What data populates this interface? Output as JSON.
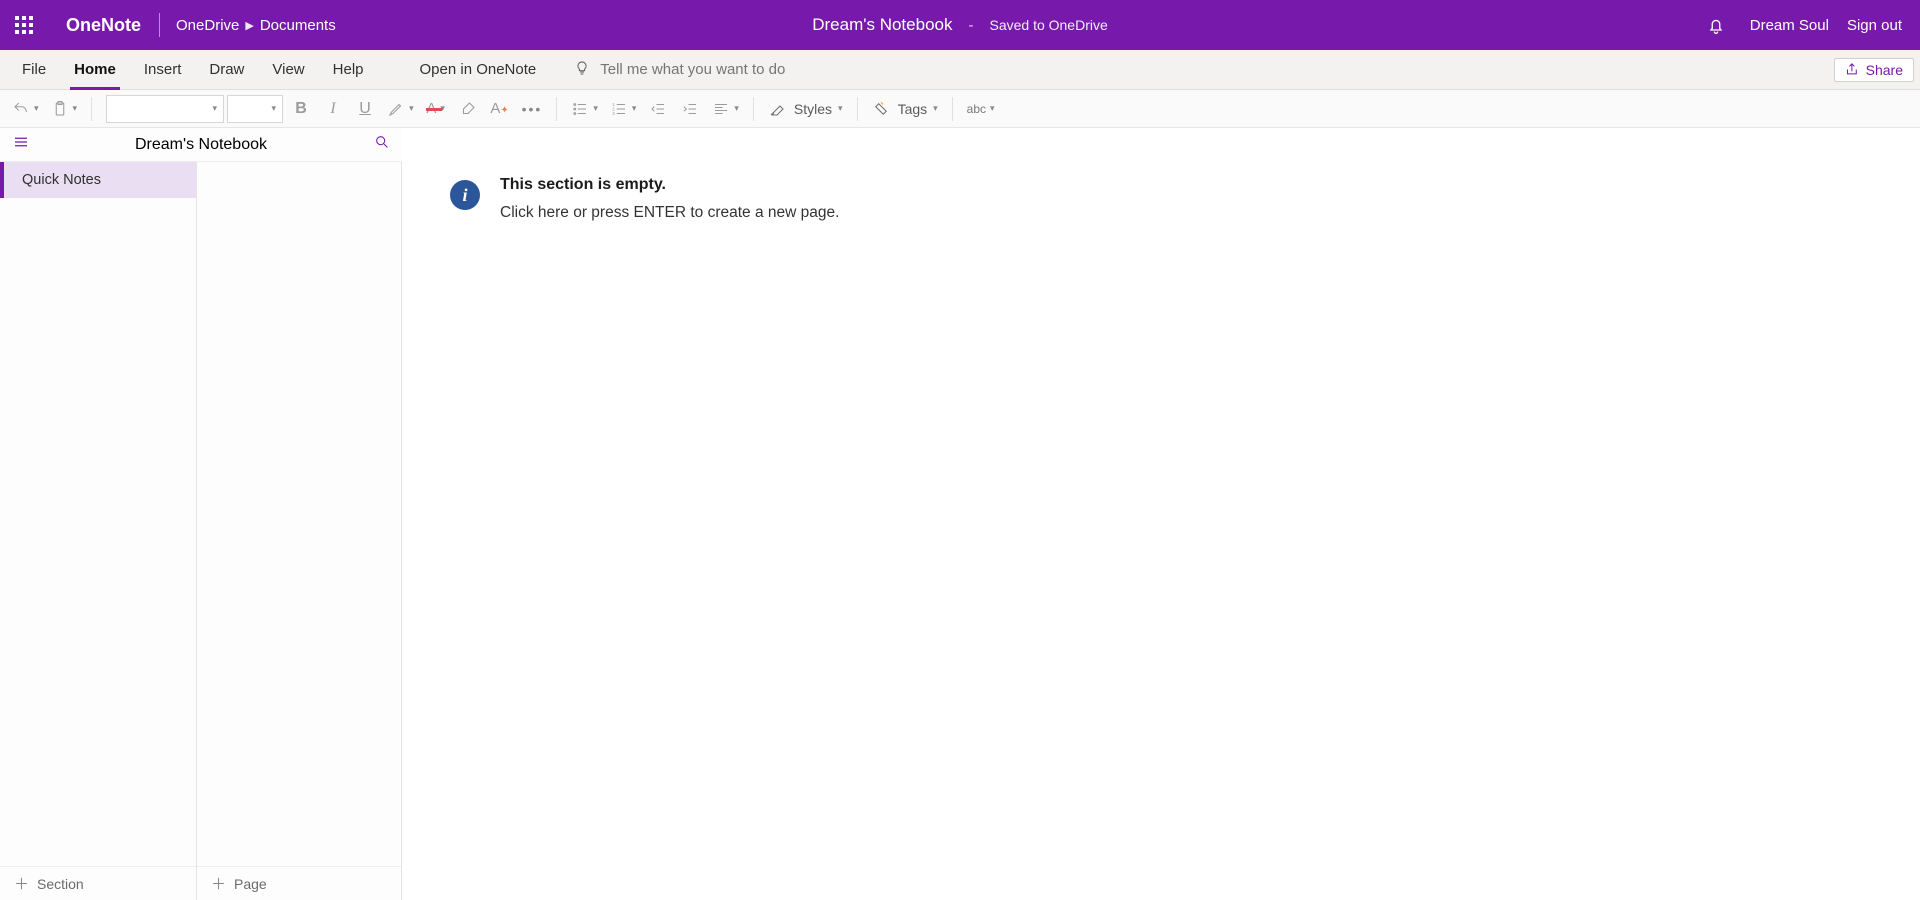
{
  "titlebar": {
    "app_name": "OneNote",
    "breadcrumb": [
      "OneDrive",
      "Documents"
    ],
    "notebook_title": "Dream's Notebook",
    "saved_status": "Saved to OneDrive",
    "user_name": "Dream Soul",
    "sign_out": "Sign out"
  },
  "ribbon": {
    "tabs": [
      "File",
      "Home",
      "Insert",
      "Draw",
      "View",
      "Help",
      "Open in OneNote"
    ],
    "active_tab": "Home",
    "tell_me_placeholder": "Tell me what you want to do",
    "share_label": "Share",
    "groups": {
      "styles_label": "Styles",
      "tags_label": "Tags"
    }
  },
  "nav": {
    "notebook_name": "Dream's Notebook",
    "sections": [
      "Quick Notes"
    ],
    "add_section_label": "Section",
    "add_page_label": "Page"
  },
  "canvas": {
    "empty_heading": "This section is empty.",
    "empty_body": "Click here or press ENTER to create a new page."
  }
}
